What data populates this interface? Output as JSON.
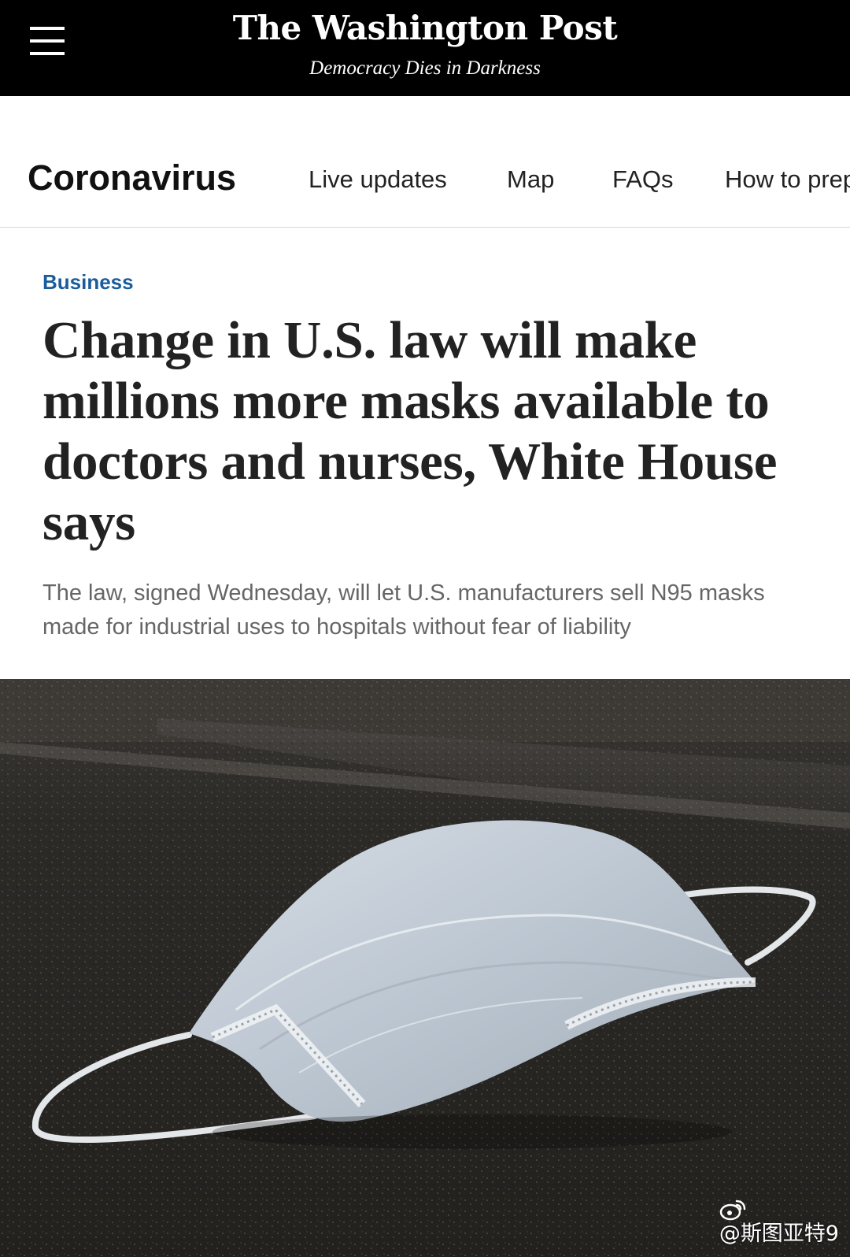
{
  "header": {
    "logo_text": "The Washington Post",
    "tagline": "Democracy Dies in Darkness",
    "menu_icon": "hamburger-menu-icon",
    "background": "#000000"
  },
  "section_nav": {
    "title": "Coronavirus",
    "links": [
      "Live updates",
      "Map",
      "FAQs",
      "How to prep"
    ]
  },
  "article": {
    "kicker": "Business",
    "kicker_color": "#1a5c9c",
    "headline": "Change in U.S. law will make millions more masks available to doctors and nurses, White House says",
    "dek": "The law, signed Wednesday, will let U.S. manufacturers sell N95 masks made for industrial uses to hospitals without fear of liability"
  },
  "photo": {
    "subject": "surgical-mask-on-countertop"
  },
  "watermark": {
    "icon": "weibo-icon",
    "handle": "@斯图亚特9"
  }
}
